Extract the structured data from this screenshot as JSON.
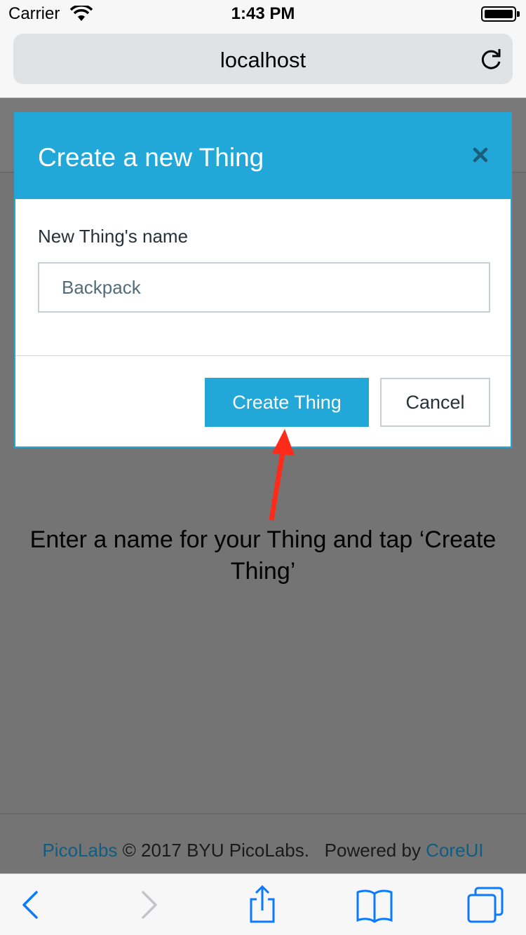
{
  "status_bar": {
    "carrier": "Carrier",
    "time": "1:43 PM"
  },
  "browser": {
    "url": "localhost"
  },
  "modal": {
    "title": "Create a new Thing",
    "field_label": "New Thing's name",
    "field_placeholder": "Backpack",
    "field_value": "",
    "create_label": "Create Thing",
    "cancel_label": "Cancel"
  },
  "annotation": {
    "line1": "Enter a name for your Thing and tap ‘Create",
    "line2": "Thing’"
  },
  "footer": {
    "brand_link": "PicoLabs",
    "copyright": " © 2017 BYU PicoLabs.",
    "powered_by": "Powered by ",
    "coreui_link": "CoreUI"
  },
  "colors": {
    "accent": "#21a8d8",
    "overlay": "#747474",
    "arrow": "#ff2a1a",
    "link": "#0f5d7f",
    "ios_blue": "#0a7aff"
  },
  "icons": [
    "wifi-icon",
    "battery-icon",
    "reload-icon",
    "close-icon",
    "back-icon",
    "forward-icon",
    "share-icon",
    "bookmarks-icon",
    "tabs-icon"
  ]
}
